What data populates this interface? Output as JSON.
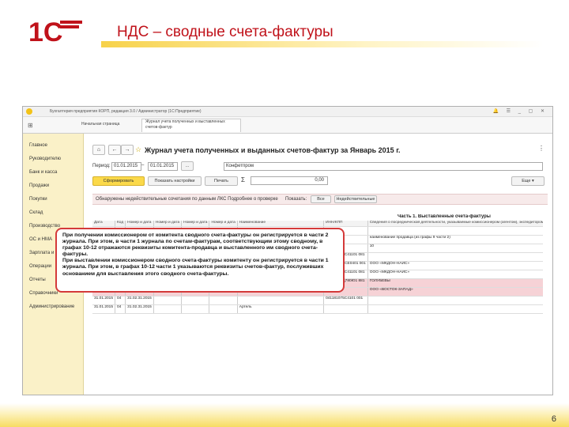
{
  "slide": {
    "title": "НДС – сводные счета-фактуры",
    "page_number": "6",
    "logo_text": "1С"
  },
  "window": {
    "title": "Бухгалтерия предприятия КОРП, редакция 3.0 / Администратор (1С:Предприятие)",
    "tabs": [
      "Начальная страница",
      "Журнал учета полученных и выставленных счетов-фактур"
    ]
  },
  "sidebar": {
    "items": [
      "Главное",
      "Руководителю",
      "Банк и касса",
      "Продажи",
      "Покупки",
      "Склад",
      "Производство",
      "ОС и НМА",
      "Зарплата и кадры",
      "Операции",
      "Отчеты",
      "Справочники",
      "Администрирование"
    ]
  },
  "doc": {
    "title": "Журнал учета полученных и выданных счетов-фактур за Январь 2015 г.",
    "period_label": "Период:",
    "date_from": "01.01.2015",
    "date_to": "01.01.2015",
    "more_btn": "...",
    "org_value": "Конфетпром",
    "form_button": "Сформировать",
    "settings_button": "Показать настройки",
    "print_button": "Печать",
    "sum_symbol": "Σ",
    "sum_value": "0,00",
    "more_menu": "Еще ▾",
    "warning_text": "Обнаружены недействительные сочетания по данным ЛКС Подробнее о проверке",
    "show_label": "Показать:",
    "show_all": "Все",
    "show_incorrect": "Недействительные",
    "part_label": "Часть 1. Выставленные счета-фактуры"
  },
  "table": {
    "header": [
      "Дата",
      "Код",
      "Номер и дата",
      "Номер и дата",
      "Номер и дата",
      "Номер и дата",
      "Наименование",
      "ИНН/КПП",
      "Сведения о посреднической деятельности, указываемые комиссионером (агентом), экспедитором или застройщиком",
      "",
      ""
    ],
    "rows": [
      [
        "",
        "",
        "",
        "",
        "",
        "",
        "",
        "",
        "",
        "",
        ""
      ],
      [
        "",
        "",
        "",
        "",
        "",
        "",
        "",
        "",
        "наименование продавца (из графы 9 части 2)",
        "ИНН/КПП продавца (из графы 9 части 2)",
        "номер и дата счета-фактуры, получен ного от продавца (из графы 4 части 2)"
      ],
      [
        "",
        "",
        "",
        "",
        "",
        "",
        "",
        "8",
        "10",
        "11",
        "12"
      ],
      [
        "",
        "",
        "",
        "",
        "",
        "",
        "",
        "041161075С41101 081",
        "",
        "",
        "«534634-3/ 02.2015"
      ],
      [
        "23.01.2015",
        "04",
        "2.02.20.2015",
        "",
        "",
        "",
        "ВОСТОК «КРЕСТЬЯН-СКОЕ ХОЗЯЙСТВО 31Э",
        "010460986СЕ0401 001",
        "ООО «МКДОН-НАЙС»",
        "77126474075С01 001",
        "5150,2/31.2015"
      ],
      [
        "25.01.2015",
        "04",
        "8.02.31.2015",
        "",
        "",
        "",
        "ООО «ВОСТОК-ЗАПАД»",
        "041161075С41101 081",
        "ООО «МКДОН-НАЙС»",
        "77126474075С01 001",
        "5150,2/31.2015"
      ],
      [
        "27.01.2015",
        "04",
        "270101.2015",
        "",
        "",
        "",
        "Компания",
        "77515055Д780Ю1 881",
        "ГОЛУБЕВЫ",
        "71136С00С91010Д 0001",
        "14566401.2015"
      ],
      [
        "",
        "",
        "",
        "",
        "",
        "",
        "",
        "",
        "ООО «ВОСТОК-ЗАПАД»",
        "041181075С41101 001",
        "14561/03.1.2015"
      ],
      [
        "31.01.2015",
        "04",
        "31.02.31.2015",
        "",
        "",
        "",
        "",
        "041181075С4101 001",
        "",
        "",
        ""
      ],
      [
        "31.01.2015",
        "04",
        "31.02.31.2015",
        "",
        "",
        "",
        "Артель",
        "",
        "",
        "",
        ""
      ]
    ]
  },
  "overlay_paragraphs": [
    "При получении комиссионером от комитента сводного счета-фактуры он регистрируется в части 2 журнала. При этом, в части 1 журнала по счетам-фактурам, соответствующим этому сводному, в графах 10-12 отражаются реквизиты комитента-продавца и выставленного им сводного счета-фактуры.",
    "При выставлении комиссионером сводного счета-фактуры комитенту он регистрируется в части 1 журнала. При этом, в графах 10-12 части 1 указываются реквизиты счетов-фактур, послуживших основанием для выставления этого сводного счета-фактуры."
  ],
  "colors": {
    "accent": "#c0121a",
    "sidebar": "#faf1c8",
    "primary_button": "#fbd94a",
    "highlight_row": "#f6d2d6",
    "overlay_border": "#d43a3a"
  }
}
